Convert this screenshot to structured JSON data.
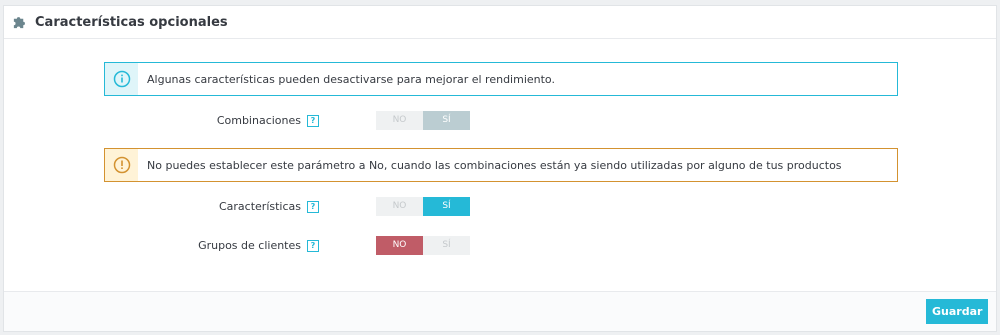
{
  "panel": {
    "title": "Características opcionales",
    "icon": "puzzle-icon"
  },
  "alerts": {
    "info": {
      "icon": "info-icon",
      "text": "Algunas características pueden desactivarse para mejorar el rendimiento."
    },
    "warning": {
      "icon": "warning-icon",
      "text": "No puedes establecer este parámetro a No, cuando las combinaciones están ya siendo utilizadas por alguno de tus productos"
    }
  },
  "help_text": "?",
  "rows": [
    {
      "label": "Combinaciones",
      "no": "NO",
      "yes": "SÍ",
      "selected": "yes",
      "disabled": true
    },
    {
      "label": "Características",
      "no": "NO",
      "yes": "SÍ",
      "selected": "yes",
      "disabled": false
    },
    {
      "label": "Grupos de clientes",
      "no": "NO",
      "yes": "SÍ",
      "selected": "no",
      "disabled": false
    }
  ],
  "footer": {
    "save_label": "Guardar"
  },
  "colors": {
    "accent": "#25b9d7",
    "warning": "#d39230",
    "danger": "#c05c67"
  }
}
